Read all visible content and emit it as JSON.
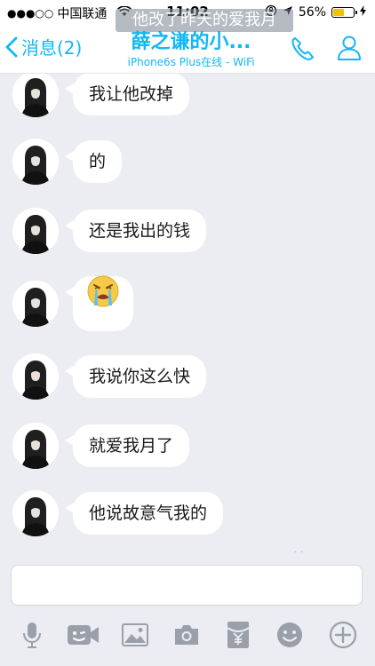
{
  "status_bar": {
    "signal": "●●●○○",
    "carrier": "中国联通",
    "time": "11:02",
    "battery": "56%",
    "battery_level": 0.56
  },
  "header": {
    "back_label": "消息(2)",
    "title": "薛之谦的小...",
    "subtitle": "iPhone6s Plus在线 - WiFi",
    "notification_text": "他改了昨天的爱我月"
  },
  "messages": [
    {
      "text": "我让他改掉"
    },
    {
      "text": "的"
    },
    {
      "text": "还是我出的钱"
    },
    {
      "emoji": "crying-face"
    },
    {
      "text": "我说你这么快"
    },
    {
      "text": "就爱我月了"
    },
    {
      "text": "他说故意气我的"
    }
  ],
  "input": {
    "value": "",
    "placeholder": ""
  },
  "toolbar": [
    "microphone-icon",
    "video-icon",
    "image-icon",
    "camera-icon",
    "red-packet-icon",
    "emoji-icon",
    "plus-icon"
  ],
  "colors": {
    "accent": "#12b7f5",
    "background": "#ebedf2",
    "bubble": "#ffffff",
    "battery": "#f2c200",
    "icon_gray": "#9aa0aa"
  }
}
